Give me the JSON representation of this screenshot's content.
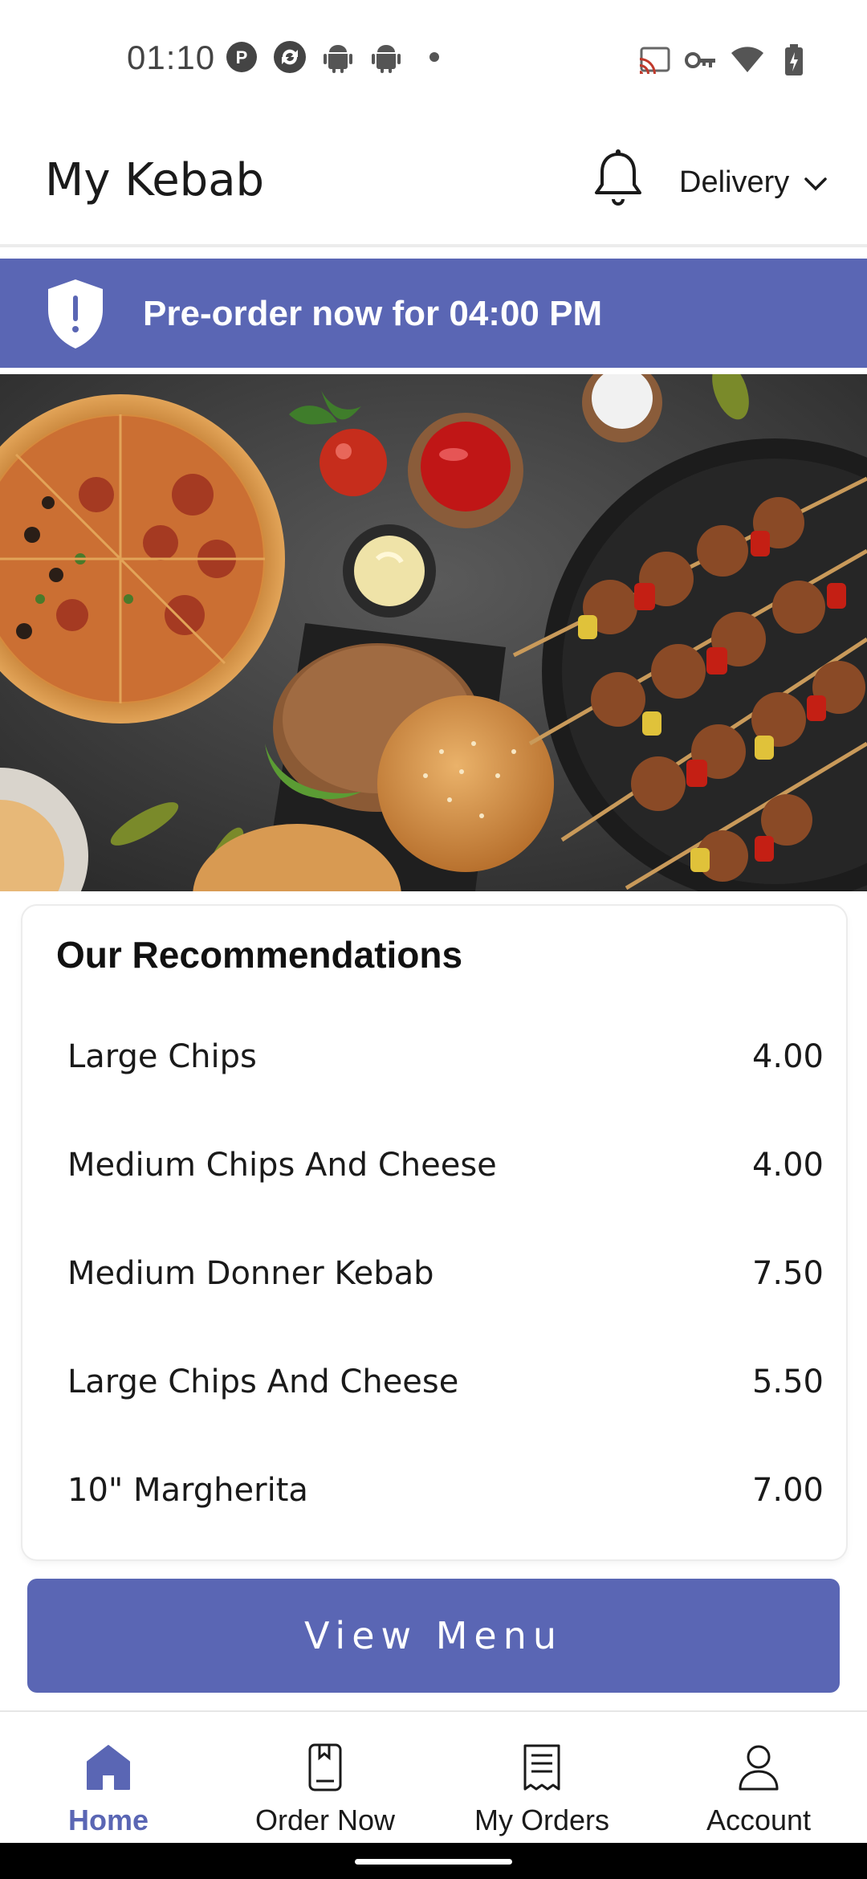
{
  "status_bar": {
    "time": "01:10",
    "left_icons": [
      "p-circle-icon",
      "sync-circle-icon",
      "android-icon",
      "android-icon",
      "dot-icon"
    ],
    "right_icons": [
      "cast-icon",
      "vpn-key-icon",
      "wifi-icon",
      "battery-charging-icon"
    ]
  },
  "header": {
    "title": "My Kebab",
    "notification_icon": "bell-icon",
    "delivery_label": "Delivery",
    "delivery_icon": "chevron-down-icon"
  },
  "banner": {
    "icon": "shield-exclamation-icon",
    "text": "Pre-order now for 04:00 PM"
  },
  "hero": {
    "icon": "food-photo"
  },
  "recommendations": {
    "title": "Our Recommendations",
    "items": [
      {
        "name": "Large Chips",
        "price": "4.00"
      },
      {
        "name": "Medium Chips And Cheese",
        "price": "4.00"
      },
      {
        "name": "Medium Donner Kebab",
        "price": "7.50"
      },
      {
        "name": "Large Chips And Cheese",
        "price": "5.50"
      },
      {
        "name": "10\" Margherita",
        "price": "7.00"
      }
    ]
  },
  "view_menu_label": "View Menu",
  "bottom_nav": {
    "items": [
      {
        "label": "Home",
        "icon": "home-icon",
        "active": true
      },
      {
        "label": "Order Now",
        "icon": "order-book-icon",
        "active": false
      },
      {
        "label": "My Orders",
        "icon": "receipt-icon",
        "active": false
      },
      {
        "label": "Account",
        "icon": "person-icon",
        "active": false
      }
    ]
  },
  "colors": {
    "accent": "#5a66b4",
    "text": "#1a1a1a",
    "background": "#ffffff"
  }
}
